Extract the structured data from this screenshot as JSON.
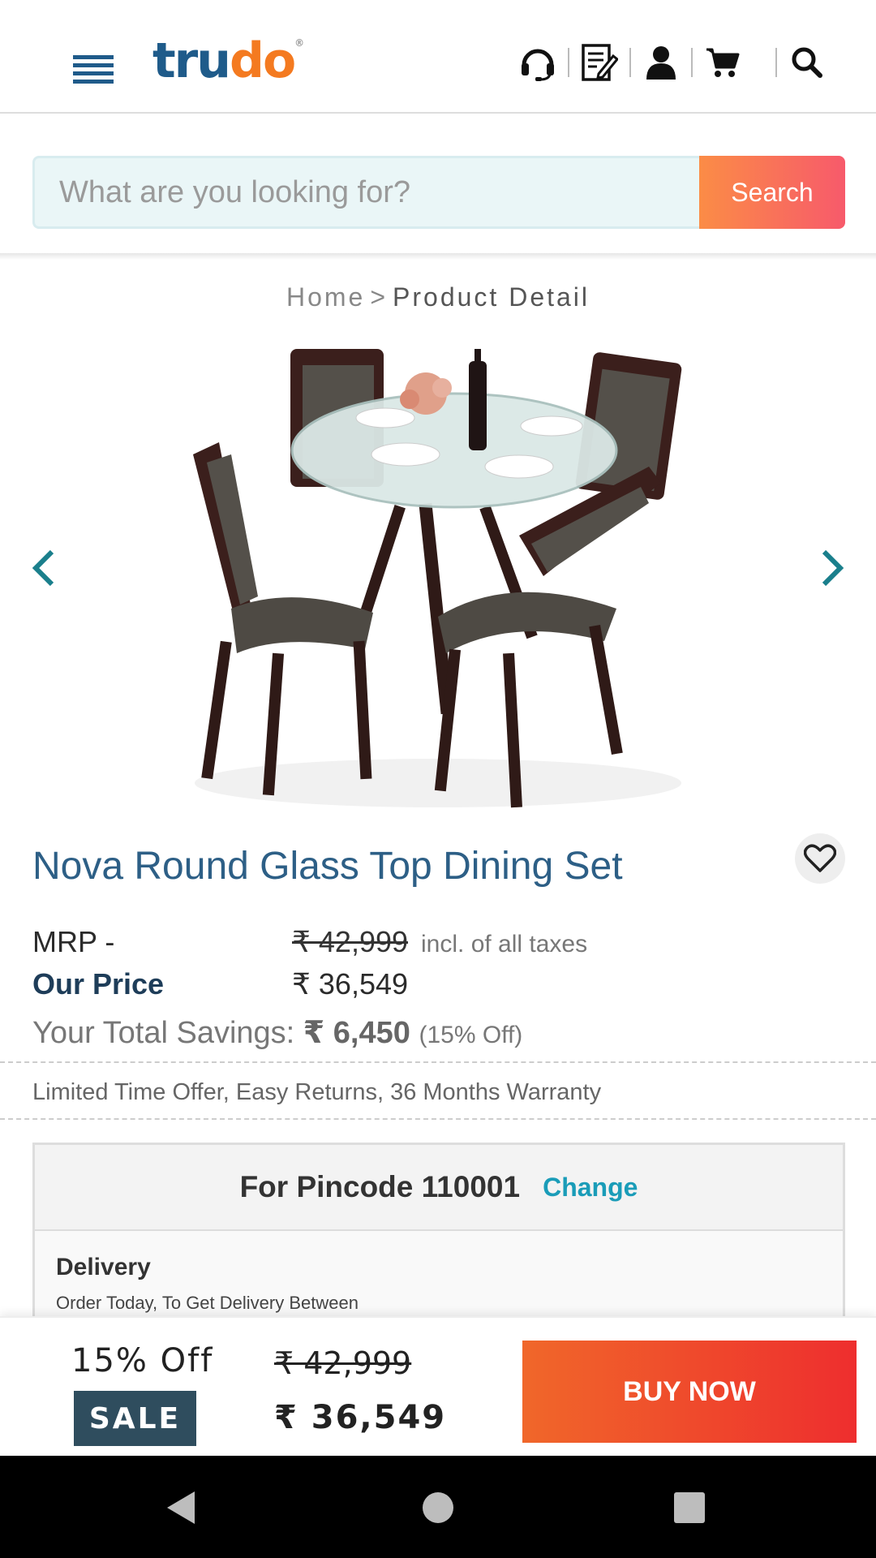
{
  "header": {
    "logo_part1": "tru",
    "logo_part2": "do",
    "logo_reg": "®",
    "icons": [
      "menu-icon",
      "headset-icon",
      "notes-icon",
      "user-icon",
      "cart-icon",
      "search-icon"
    ]
  },
  "search": {
    "placeholder": "What are you looking for?",
    "button_label": "Search"
  },
  "breadcrumb": {
    "home": "Home",
    "separator": ">",
    "current": "Product Detail"
  },
  "product": {
    "title": "Nova Round Glass Top Dining Set",
    "mrp_label": "MRP -",
    "mrp_value": "₹ 42,999",
    "taxes_note": "incl. of all taxes",
    "our_price_label": "Our Price",
    "our_price_value": "₹ 36,549",
    "savings_label": "Your Total Savings:",
    "savings_value": "₹ 6,450",
    "savings_pct": "(15% Off)",
    "offer_text": "Limited Time Offer, Easy Returns, 36 Months Warranty"
  },
  "pincode": {
    "label": "For Pincode 110001",
    "change_label": "Change",
    "delivery_title": "Delivery",
    "delivery_text": "Order Today, To Get Delivery Between"
  },
  "bottom_bar": {
    "discount": "15% Off",
    "sale_badge": "SALE",
    "mrp": "₹ 42,999",
    "price": "₹ 36,549",
    "buy_label": "BUY NOW"
  },
  "colors": {
    "brand_blue": "#1f5b8a",
    "brand_orange": "#f47a20",
    "accent_teal": "#1a9cb8",
    "buy_gradient_start": "#f0672a",
    "buy_gradient_end": "#ee2e2e"
  }
}
